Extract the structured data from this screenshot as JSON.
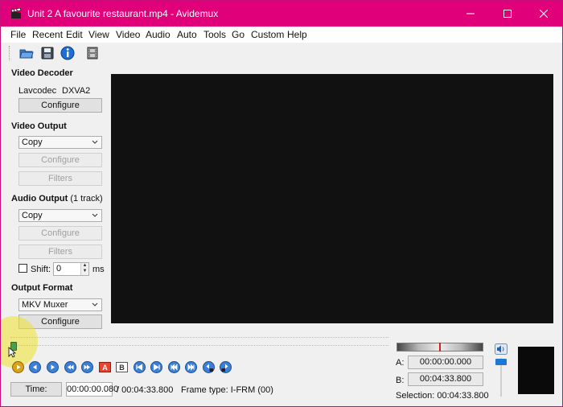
{
  "window": {
    "title": "Unit 2 A favourite restaurant.mp4 - Avidemux",
    "accent_color": "#e0007a"
  },
  "menu": [
    "File",
    "Recent",
    "Edit",
    "View",
    "Video",
    "Audio",
    "Auto",
    "Tools",
    "Go",
    "Custom",
    "Help"
  ],
  "toolbar": {
    "icons": [
      "open-folder-icon",
      "save-disk-icon",
      "info-icon",
      "film-strip-icon"
    ]
  },
  "video_decoder": {
    "title": "Video Decoder",
    "decoder_label": "Lavcodec",
    "decoder_value": "DXVA2",
    "configure_label": "Configure"
  },
  "video_output": {
    "title": "Video Output",
    "codec_value": "Copy",
    "configure_label": "Configure",
    "filters_label": "Filters"
  },
  "audio_output": {
    "title": "Audio Output",
    "tracks": "(1 track)",
    "codec_value": "Copy",
    "configure_label": "Configure",
    "filters_label": "Filters",
    "shift_label": "Shift:",
    "shift_value": "0",
    "shift_unit": "ms"
  },
  "output_format": {
    "title": "Output Format",
    "muxer_value": "MKV Muxer",
    "configure_label": "Configure"
  },
  "status": {
    "time_button": "Time:",
    "current_time": "00:00:00.080",
    "total_time": "/ 00:04:33.800",
    "frame_type": "Frame type:  I-FRM (00)"
  },
  "markers": {
    "a_label": "A:",
    "a_value": "00:00:00.000",
    "b_label": "B:",
    "b_value": "00:04:33.800",
    "selection": "Selection: 00:04:33.800"
  }
}
